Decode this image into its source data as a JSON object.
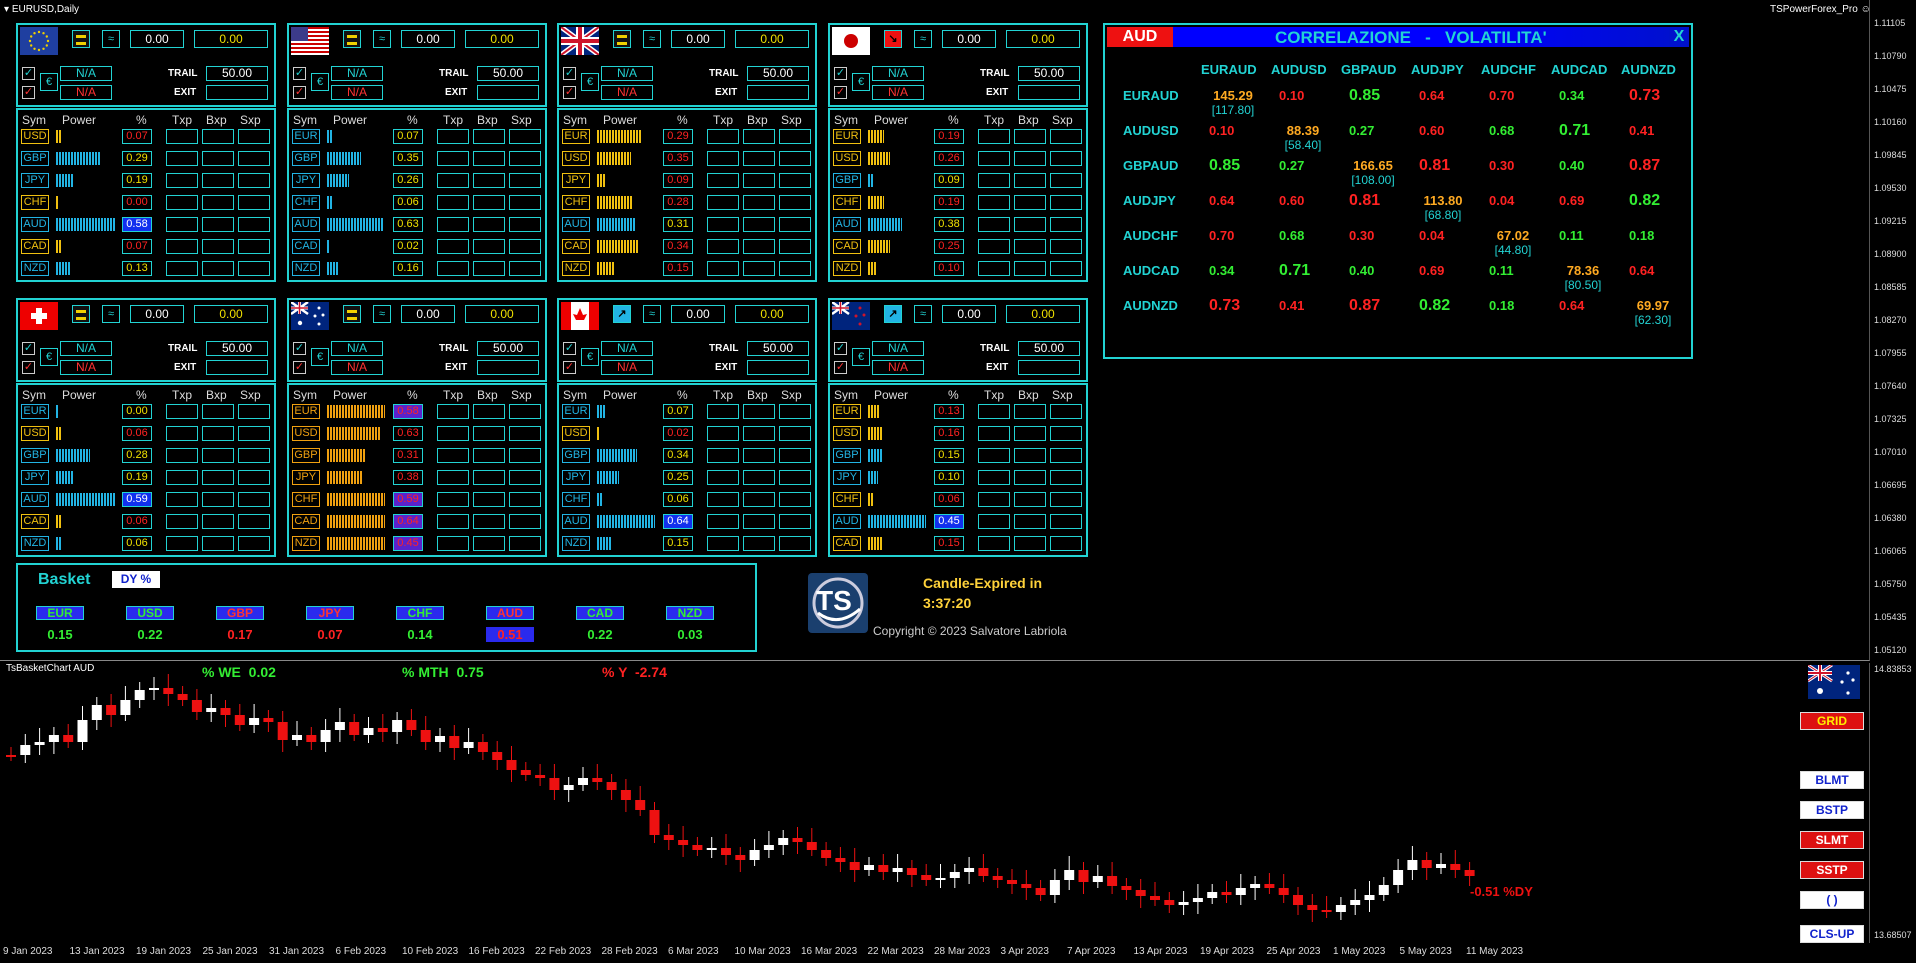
{
  "window": {
    "title": "EURUSD,Daily",
    "indicator": "TSPowerForex_Pro",
    "subchart_title": "TsBasketChart AUD"
  },
  "price_axis": [
    "1.11105",
    "1.10790",
    "1.10475",
    "1.10160",
    "1.09845",
    "1.09530",
    "1.09215",
    "1.08900",
    "1.08585",
    "1.08270",
    "1.07955",
    "1.07640",
    "1.07325",
    "1.07010",
    "1.06695",
    "1.06380",
    "1.06065",
    "1.05750",
    "1.05435",
    "1.05120"
  ],
  "sub_axis": {
    "top": "14.83853",
    "bottom": "13.68507"
  },
  "labels": {
    "trail": "TRAIL",
    "exit": "EXIT",
    "na": "N/A",
    "sym": "Sym",
    "power": "Power",
    "pct": "%",
    "txp": "Txp",
    "bxp": "Bxp",
    "sxp": "Sxp",
    "zero": "0.00",
    "trail_val": "50.00",
    "check": "✓",
    "euro": "€"
  },
  "panels": [
    {
      "flag": "eu",
      "status": "equal",
      "rows": [
        {
          "sym": "USD",
          "pct": "0.07",
          "c": "#ff2222",
          "bar": 5,
          "bc": "#f0c010"
        },
        {
          "sym": "GBP",
          "pct": "0.29",
          "c": "#f0e000",
          "bar": 44,
          "bc": "#22b4e4"
        },
        {
          "sym": "JPY",
          "pct": "0.19",
          "c": "#f0e000",
          "bar": 18,
          "bc": "#22b4e4"
        },
        {
          "sym": "CHF",
          "pct": "0.00",
          "c": "#ff2222",
          "bar": 3,
          "bc": "#f0c010"
        },
        {
          "sym": "AUD",
          "pct": "0.58",
          "c": "#ffffff",
          "bar": 60,
          "bc": "#22b4e4",
          "hl": true
        },
        {
          "sym": "CAD",
          "pct": "0.07",
          "c": "#ff2222",
          "bar": 5,
          "bc": "#f0c010"
        },
        {
          "sym": "NZD",
          "pct": "0.13",
          "c": "#f0e000",
          "bar": 14,
          "bc": "#22b4e4"
        }
      ]
    },
    {
      "flag": "us",
      "status": "equal",
      "rows": [
        {
          "sym": "EUR",
          "pct": "0.07",
          "c": "#f0e000",
          "bar": 5,
          "bc": "#22b4e4"
        },
        {
          "sym": "GBP",
          "pct": "0.35",
          "c": "#f0e000",
          "bar": 34,
          "bc": "#22b4e4"
        },
        {
          "sym": "JPY",
          "pct": "0.26",
          "c": "#f0e000",
          "bar": 22,
          "bc": "#22b4e4"
        },
        {
          "sym": "CHF",
          "pct": "0.06",
          "c": "#f0e000",
          "bar": 5,
          "bc": "#22b4e4"
        },
        {
          "sym": "AUD",
          "pct": "0.63",
          "c": "#f0e000",
          "bar": 56,
          "bc": "#22b4e4"
        },
        {
          "sym": "CAD",
          "pct": "0.02",
          "c": "#f0e000",
          "bar": 3,
          "bc": "#22b4e4"
        },
        {
          "sym": "NZD",
          "pct": "0.16",
          "c": "#f0e000",
          "bar": 12,
          "bc": "#22b4e4"
        }
      ]
    },
    {
      "flag": "uk",
      "status": "equal",
      "rows": [
        {
          "sym": "EUR",
          "pct": "0.29",
          "c": "#ff2222",
          "bar": 44,
          "bc": "#f0c010"
        },
        {
          "sym": "USD",
          "pct": "0.35",
          "c": "#ff2222",
          "bar": 34,
          "bc": "#f0c010"
        },
        {
          "sym": "JPY",
          "pct": "0.09",
          "c": "#ff2222",
          "bar": 8,
          "bc": "#f0c010"
        },
        {
          "sym": "CHF",
          "pct": "0.28",
          "c": "#ff2222",
          "bar": 36,
          "bc": "#f0c010"
        },
        {
          "sym": "AUD",
          "pct": "0.31",
          "c": "#f0e000",
          "bar": 38,
          "bc": "#22b4e4"
        },
        {
          "sym": "CAD",
          "pct": "0.34",
          "c": "#ff2222",
          "bar": 42,
          "bc": "#f0c010"
        },
        {
          "sym": "NZD",
          "pct": "0.15",
          "c": "#ff2222",
          "bar": 18,
          "bc": "#f0c010"
        }
      ]
    },
    {
      "flag": "jp",
      "status": "down",
      "rows": [
        {
          "sym": "EUR",
          "pct": "0.19",
          "c": "#ff2222",
          "bar": 16,
          "bc": "#f0c010"
        },
        {
          "sym": "USD",
          "pct": "0.26",
          "c": "#ff2222",
          "bar": 22,
          "bc": "#f0c010"
        },
        {
          "sym": "GBP",
          "pct": "0.09",
          "c": "#f0e000",
          "bar": 5,
          "bc": "#22b4e4"
        },
        {
          "sym": "CHF",
          "pct": "0.19",
          "c": "#ff2222",
          "bar": 16,
          "bc": "#f0c010"
        },
        {
          "sym": "AUD",
          "pct": "0.38",
          "c": "#f0e000",
          "bar": 34,
          "bc": "#22b4e4"
        },
        {
          "sym": "CAD",
          "pct": "0.25",
          "c": "#ff2222",
          "bar": 22,
          "bc": "#f0c010"
        },
        {
          "sym": "NZD",
          "pct": "0.10",
          "c": "#ff2222",
          "bar": 8,
          "bc": "#f0c010"
        }
      ]
    },
    {
      "flag": "ch",
      "status": "equal",
      "rows": [
        {
          "sym": "EUR",
          "pct": "0.00",
          "c": "#f0e000",
          "bar": 3,
          "bc": "#22b4e4"
        },
        {
          "sym": "USD",
          "pct": "0.06",
          "c": "#ff2222",
          "bar": 5,
          "bc": "#f0c010"
        },
        {
          "sym": "GBP",
          "pct": "0.28",
          "c": "#f0e000",
          "bar": 34,
          "bc": "#22b4e4"
        },
        {
          "sym": "JPY",
          "pct": "0.19",
          "c": "#f0e000",
          "bar": 18,
          "bc": "#22b4e4"
        },
        {
          "sym": "AUD",
          "pct": "0.59",
          "c": "#ffffff",
          "bar": 60,
          "bc": "#22b4e4",
          "hl": true
        },
        {
          "sym": "CAD",
          "pct": "0.06",
          "c": "#ff2222",
          "bar": 5,
          "bc": "#f0c010"
        },
        {
          "sym": "NZD",
          "pct": "0.06",
          "c": "#f0e000",
          "bar": 5,
          "bc": "#22b4e4"
        }
      ]
    },
    {
      "flag": "au",
      "status": "equal",
      "rows": [
        {
          "sym": "EUR",
          "pct": "0.58",
          "c": "#ff2222",
          "bar": 58,
          "bc": "#f0a010",
          "hl2": true
        },
        {
          "sym": "USD",
          "pct": "0.63",
          "c": "#ff2222",
          "bar": 54,
          "bc": "#f0a010"
        },
        {
          "sym": "GBP",
          "pct": "0.31",
          "c": "#ff2222",
          "bar": 38,
          "bc": "#f0a010"
        },
        {
          "sym": "JPY",
          "pct": "0.38",
          "c": "#ff2222",
          "bar": 36,
          "bc": "#f0a010"
        },
        {
          "sym": "CHF",
          "pct": "0.59",
          "c": "#ff2222",
          "bar": 58,
          "bc": "#f0a010",
          "hl2": true
        },
        {
          "sym": "CAD",
          "pct": "0.64",
          "c": "#ff2222",
          "bar": 58,
          "bc": "#f0a010",
          "hl2": true
        },
        {
          "sym": "NZD",
          "pct": "0.45",
          "c": "#ff2222",
          "bar": 58,
          "bc": "#f0a010",
          "hl2": true
        }
      ]
    },
    {
      "flag": "ca",
      "status": "up",
      "rows": [
        {
          "sym": "EUR",
          "pct": "0.07",
          "c": "#f0e000",
          "bar": 8,
          "bc": "#22b4e4"
        },
        {
          "sym": "USD",
          "pct": "0.02",
          "c": "#ff2222",
          "bar": 3,
          "bc": "#f0c010"
        },
        {
          "sym": "GBP",
          "pct": "0.34",
          "c": "#f0e000",
          "bar": 40,
          "bc": "#22b4e4"
        },
        {
          "sym": "JPY",
          "pct": "0.25",
          "c": "#f0e000",
          "bar": 22,
          "bc": "#22b4e4"
        },
        {
          "sym": "CHF",
          "pct": "0.06",
          "c": "#f0e000",
          "bar": 5,
          "bc": "#22b4e4"
        },
        {
          "sym": "AUD",
          "pct": "0.64",
          "c": "#ffffff",
          "bar": 58,
          "bc": "#22b4e4",
          "hl": true
        },
        {
          "sym": "NZD",
          "pct": "0.15",
          "c": "#f0e000",
          "bar": 14,
          "bc": "#22b4e4"
        }
      ]
    },
    {
      "flag": "nz",
      "status": "up",
      "rows": [
        {
          "sym": "EUR",
          "pct": "0.13",
          "c": "#ff2222",
          "bar": 12,
          "bc": "#f0c010"
        },
        {
          "sym": "USD",
          "pct": "0.16",
          "c": "#ff2222",
          "bar": 14,
          "bc": "#f0c010"
        },
        {
          "sym": "GBP",
          "pct": "0.15",
          "c": "#f0e000",
          "bar": 14,
          "bc": "#22b4e4"
        },
        {
          "sym": "JPY",
          "pct": "0.10",
          "c": "#f0e000",
          "bar": 10,
          "bc": "#22b4e4"
        },
        {
          "sym": "CHF",
          "pct": "0.06",
          "c": "#ff2222",
          "bar": 5,
          "bc": "#f0c010"
        },
        {
          "sym": "AUD",
          "pct": "0.45",
          "c": "#ffffff",
          "bar": 58,
          "bc": "#22b4e4",
          "hl": true
        },
        {
          "sym": "CAD",
          "pct": "0.15",
          "c": "#ff2222",
          "bar": 14,
          "bc": "#f0c010"
        }
      ]
    }
  ],
  "basket": {
    "title": "Basket",
    "mode": "DY %",
    "items": [
      {
        "sym": "EUR",
        "val": "0.15",
        "c": "#33ee33",
        "bg": "#1b7a1b"
      },
      {
        "sym": "USD",
        "val": "0.22",
        "c": "#33ee33",
        "bg": "#1b7a1b"
      },
      {
        "sym": "GBP",
        "val": "0.17",
        "c": "#ff2222",
        "bg": "#aa1111"
      },
      {
        "sym": "JPY",
        "val": "0.07",
        "c": "#ff2222",
        "bg": "#aa1111"
      },
      {
        "sym": "CHF",
        "val": "0.14",
        "c": "#33ee33",
        "bg": "#1b7a1b"
      },
      {
        "sym": "AUD",
        "val": "0.51",
        "c": "#ff2222",
        "bg": "#aa1111",
        "hl": true
      },
      {
        "sym": "CAD",
        "val": "0.22",
        "c": "#33ee33",
        "bg": "#1b7a1b"
      },
      {
        "sym": "NZD",
        "val": "0.03",
        "c": "#33ee33",
        "bg": "#1b7a1b"
      }
    ]
  },
  "timer": {
    "label": "Candle-Expired in",
    "value": "3:37:20"
  },
  "logo": {
    "text": "TS"
  },
  "copyright": "Copyright © 2023 Salvatore Labriola",
  "corr": {
    "cur": "AUD",
    "title": "CORRELAZIONE   -   VOLATILITA'",
    "close": "X",
    "cols": [
      "EURAUD",
      "AUDUSD",
      "GBPAUD",
      "AUDJPY",
      "AUDCHF",
      "AUDCAD",
      "AUDNZD"
    ],
    "rows": [
      {
        "name": "EURAUD",
        "cells": [
          {
            "v": "145.29",
            "s": "[117.80]",
            "c": "#ffaa22"
          },
          {
            "v": "0.10",
            "c": "#ff2222"
          },
          {
            "v": "0.85",
            "c": "#33ee33",
            "b": 1
          },
          {
            "v": "0.64",
            "c": "#ff2222"
          },
          {
            "v": "0.70",
            "c": "#ff2222"
          },
          {
            "v": "0.34",
            "c": "#33ee33"
          },
          {
            "v": "0.73",
            "c": "#ff2222",
            "b": 1
          }
        ]
      },
      {
        "name": "AUDUSD",
        "cells": [
          {
            "v": "0.10",
            "c": "#ff2222"
          },
          {
            "v": "88.39",
            "s": "[58.40]",
            "c": "#ffaa22"
          },
          {
            "v": "0.27",
            "c": "#33ee33"
          },
          {
            "v": "0.60",
            "c": "#ff2222"
          },
          {
            "v": "0.68",
            "c": "#33ee33"
          },
          {
            "v": "0.71",
            "c": "#33ee33",
            "b": 1
          },
          {
            "v": "0.41",
            "c": "#ff2222"
          }
        ]
      },
      {
        "name": "GBPAUD",
        "cells": [
          {
            "v": "0.85",
            "c": "#33ee33",
            "b": 1
          },
          {
            "v": "0.27",
            "c": "#33ee33"
          },
          {
            "v": "166.65",
            "s": "[108.00]",
            "c": "#ffaa22"
          },
          {
            "v": "0.81",
            "c": "#ff2222",
            "b": 1
          },
          {
            "v": "0.30",
            "c": "#ff2222"
          },
          {
            "v": "0.40",
            "c": "#33ee33"
          },
          {
            "v": "0.87",
            "c": "#ff2222",
            "b": 1
          }
        ]
      },
      {
        "name": "AUDJPY",
        "cells": [
          {
            "v": "0.64",
            "c": "#ff2222"
          },
          {
            "v": "0.60",
            "c": "#ff2222"
          },
          {
            "v": "0.81",
            "c": "#ff2222",
            "b": 1
          },
          {
            "v": "113.80",
            "s": "[68.80]",
            "c": "#ffaa22"
          },
          {
            "v": "0.04",
            "c": "#ff2222"
          },
          {
            "v": "0.69",
            "c": "#ff2222"
          },
          {
            "v": "0.82",
            "c": "#33ee33",
            "b": 1
          }
        ]
      },
      {
        "name": "AUDCHF",
        "cells": [
          {
            "v": "0.70",
            "c": "#ff2222"
          },
          {
            "v": "0.68",
            "c": "#33ee33"
          },
          {
            "v": "0.30",
            "c": "#ff2222"
          },
          {
            "v": "0.04",
            "c": "#ff2222"
          },
          {
            "v": "67.02",
            "s": "[44.80]",
            "c": "#ffaa22"
          },
          {
            "v": "0.11",
            "c": "#33ee33"
          },
          {
            "v": "0.18",
            "c": "#33ee33"
          }
        ]
      },
      {
        "name": "AUDCAD",
        "cells": [
          {
            "v": "0.34",
            "c": "#33ee33"
          },
          {
            "v": "0.71",
            "c": "#33ee33",
            "b": 1
          },
          {
            "v": "0.40",
            "c": "#33ee33"
          },
          {
            "v": "0.69",
            "c": "#ff2222"
          },
          {
            "v": "0.11",
            "c": "#33ee33"
          },
          {
            "v": "78.36",
            "s": "[80.50]",
            "c": "#ffaa22"
          },
          {
            "v": "0.64",
            "c": "#ff2222"
          }
        ]
      },
      {
        "name": "AUDNZD",
        "cells": [
          {
            "v": "0.73",
            "c": "#ff2222",
            "b": 1
          },
          {
            "v": "0.41",
            "c": "#ff2222"
          },
          {
            "v": "0.87",
            "c": "#ff2222",
            "b": 1
          },
          {
            "v": "0.82",
            "c": "#33ee33",
            "b": 1
          },
          {
            "v": "0.18",
            "c": "#33ee33"
          },
          {
            "v": "0.64",
            "c": "#ff2222"
          },
          {
            "v": "69.97",
            "s": "[62.30]",
            "c": "#ffaa22"
          }
        ]
      }
    ]
  },
  "stats": [
    {
      "t": "% WE  0.02",
      "c": "#33ee33"
    },
    {
      "t": "% MTH  0.75",
      "c": "#33ee33"
    },
    {
      "t": "% Y  -2.74",
      "c": "#ff2222"
    }
  ],
  "buttons": [
    {
      "t": "GRID",
      "bg": "#dd1111",
      "c": "#ffee00",
      "k": "grid"
    },
    {
      "t": "BLMT",
      "bg": "#ffffff",
      "c": "#1122cc",
      "k": "blmt"
    },
    {
      "t": "BSTP",
      "bg": "#ffffff",
      "c": "#1122cc",
      "k": "bstp"
    },
    {
      "t": "SLMT",
      "bg": "#dd1111",
      "c": "#ffffff",
      "k": "slmt"
    },
    {
      "t": "SSTP",
      "bg": "#dd1111",
      "c": "#ffffff",
      "k": "sstp"
    },
    {
      "t": "( )",
      "bg": "#ffffff",
      "c": "#1122cc",
      "k": "paren"
    },
    {
      "t": "CLS-UP",
      "bg": "#ffffff",
      "c": "#1122cc",
      "k": "clsup"
    }
  ],
  "dy_label": "-0.51 %DY",
  "dates": [
    "9 Jan 2023",
    "13 Jan 2023",
    "19 Jan 2023",
    "25 Jan 2023",
    "31 Jan 2023",
    "6 Feb 2023",
    "10 Feb 2023",
    "16 Feb 2023",
    "22 Feb 2023",
    "28 Feb 2023",
    "6 Mar 2023",
    "10 Mar 2023",
    "16 Mar 2023",
    "22 Mar 2023",
    "28 Mar 2023",
    "3 Apr 2023",
    "7 Apr 2023",
    "13 Apr 2023",
    "19 Apr 2023",
    "25 Apr 2023",
    "1 May 2023",
    "5 May 2023",
    "11 May 2023"
  ],
  "colors": {
    "accent": "#22d3d3",
    "bull": "#ffffff",
    "bear": "#ee1111"
  }
}
